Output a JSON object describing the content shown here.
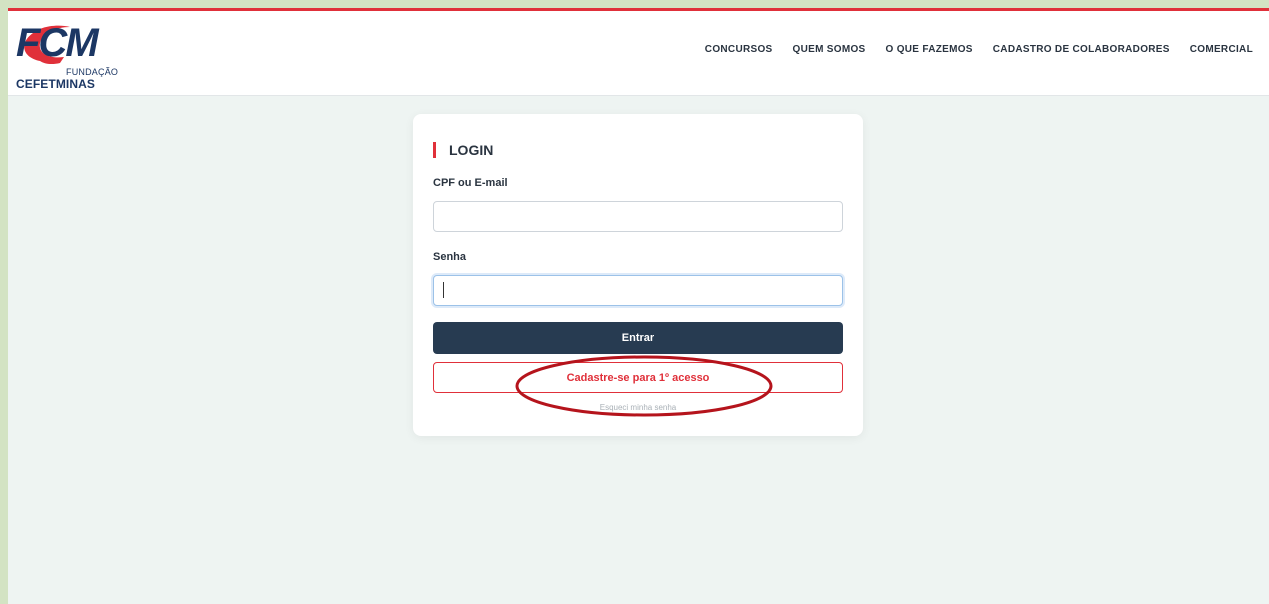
{
  "brand": {
    "logo_main": "FCM",
    "logo_sub1": "FUNDAÇÃO",
    "logo_sub2": "CEFETMINAS",
    "accent_color": "#e0303a",
    "navy_color": "#1c3764"
  },
  "nav": {
    "items": [
      "CONCURSOS",
      "QUEM SOMOS",
      "O QUE FAZEMOS",
      "CADASTRO DE COLABORADORES",
      "COMERCIAL"
    ]
  },
  "login": {
    "title": "LOGIN",
    "cpf_label": "CPF ou E-mail",
    "cpf_value": "",
    "senha_label": "Senha",
    "senha_value": "",
    "entrar_label": "Entrar",
    "cadastro_label": "Cadastre-se para 1º acesso",
    "forgot_label": "Esqueci minha senha"
  },
  "annotation": {
    "color": "#b5141c"
  }
}
